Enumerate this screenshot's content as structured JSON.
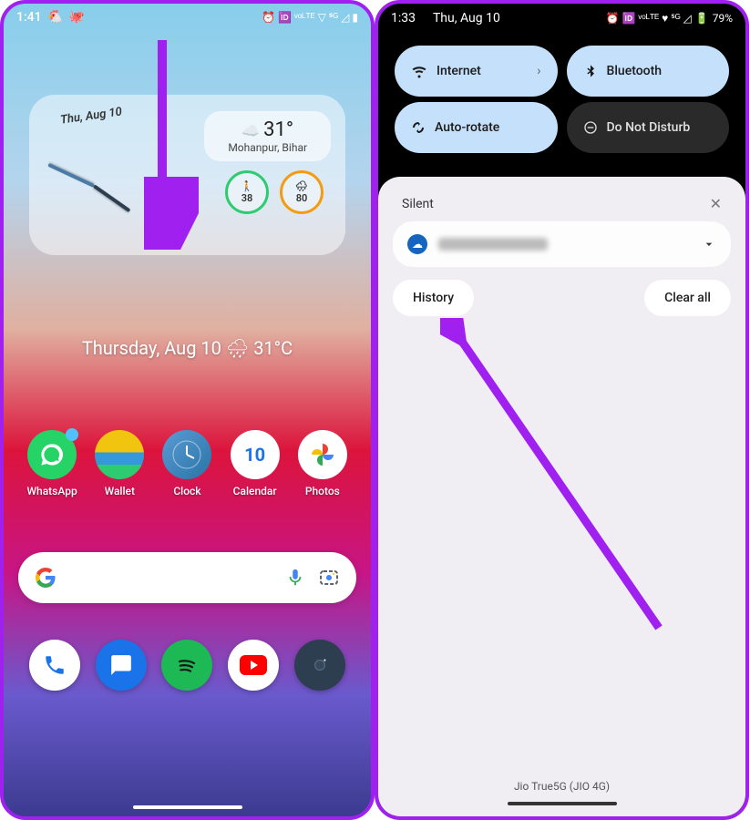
{
  "left": {
    "status": {
      "time": "1:41",
      "icons": "⏰ 🆔 ᵛᵒᴸᵀᴱ ▽ ⁵ᴳ ◿ ▮"
    },
    "widget": {
      "date": "Thu, Aug 10",
      "temp": "31°",
      "location": "Mohanpur, Bihar",
      "steps": "38",
      "weather_stat": "80",
      "weather_icon": "☁️"
    },
    "clock_text_date": "Thursday, Aug 10",
    "clock_text_temp": "🌧 31°C",
    "apps": {
      "a0": "WhatsApp",
      "a1": "Wallet",
      "a2": "Clock",
      "a3": "Calendar",
      "cal_day": "10",
      "a4": "Photos"
    }
  },
  "right": {
    "status": {
      "time": "1:33",
      "date": "Thu, Aug 10",
      "icons": "⏰ 🆔 ᵛᵒᴸᵀᴱ ♥ ⁵ᴳ ◿",
      "battery": "79%"
    },
    "qs": {
      "internet": "Internet",
      "bluetooth": "Bluetooth",
      "autorotate": "Auto-rotate",
      "dnd": "Do Not Disturb"
    },
    "shade": {
      "silent": "Silent",
      "history": "History",
      "clearall": "Clear all",
      "carrier": "Jio True5G (JIO 4G)"
    }
  }
}
